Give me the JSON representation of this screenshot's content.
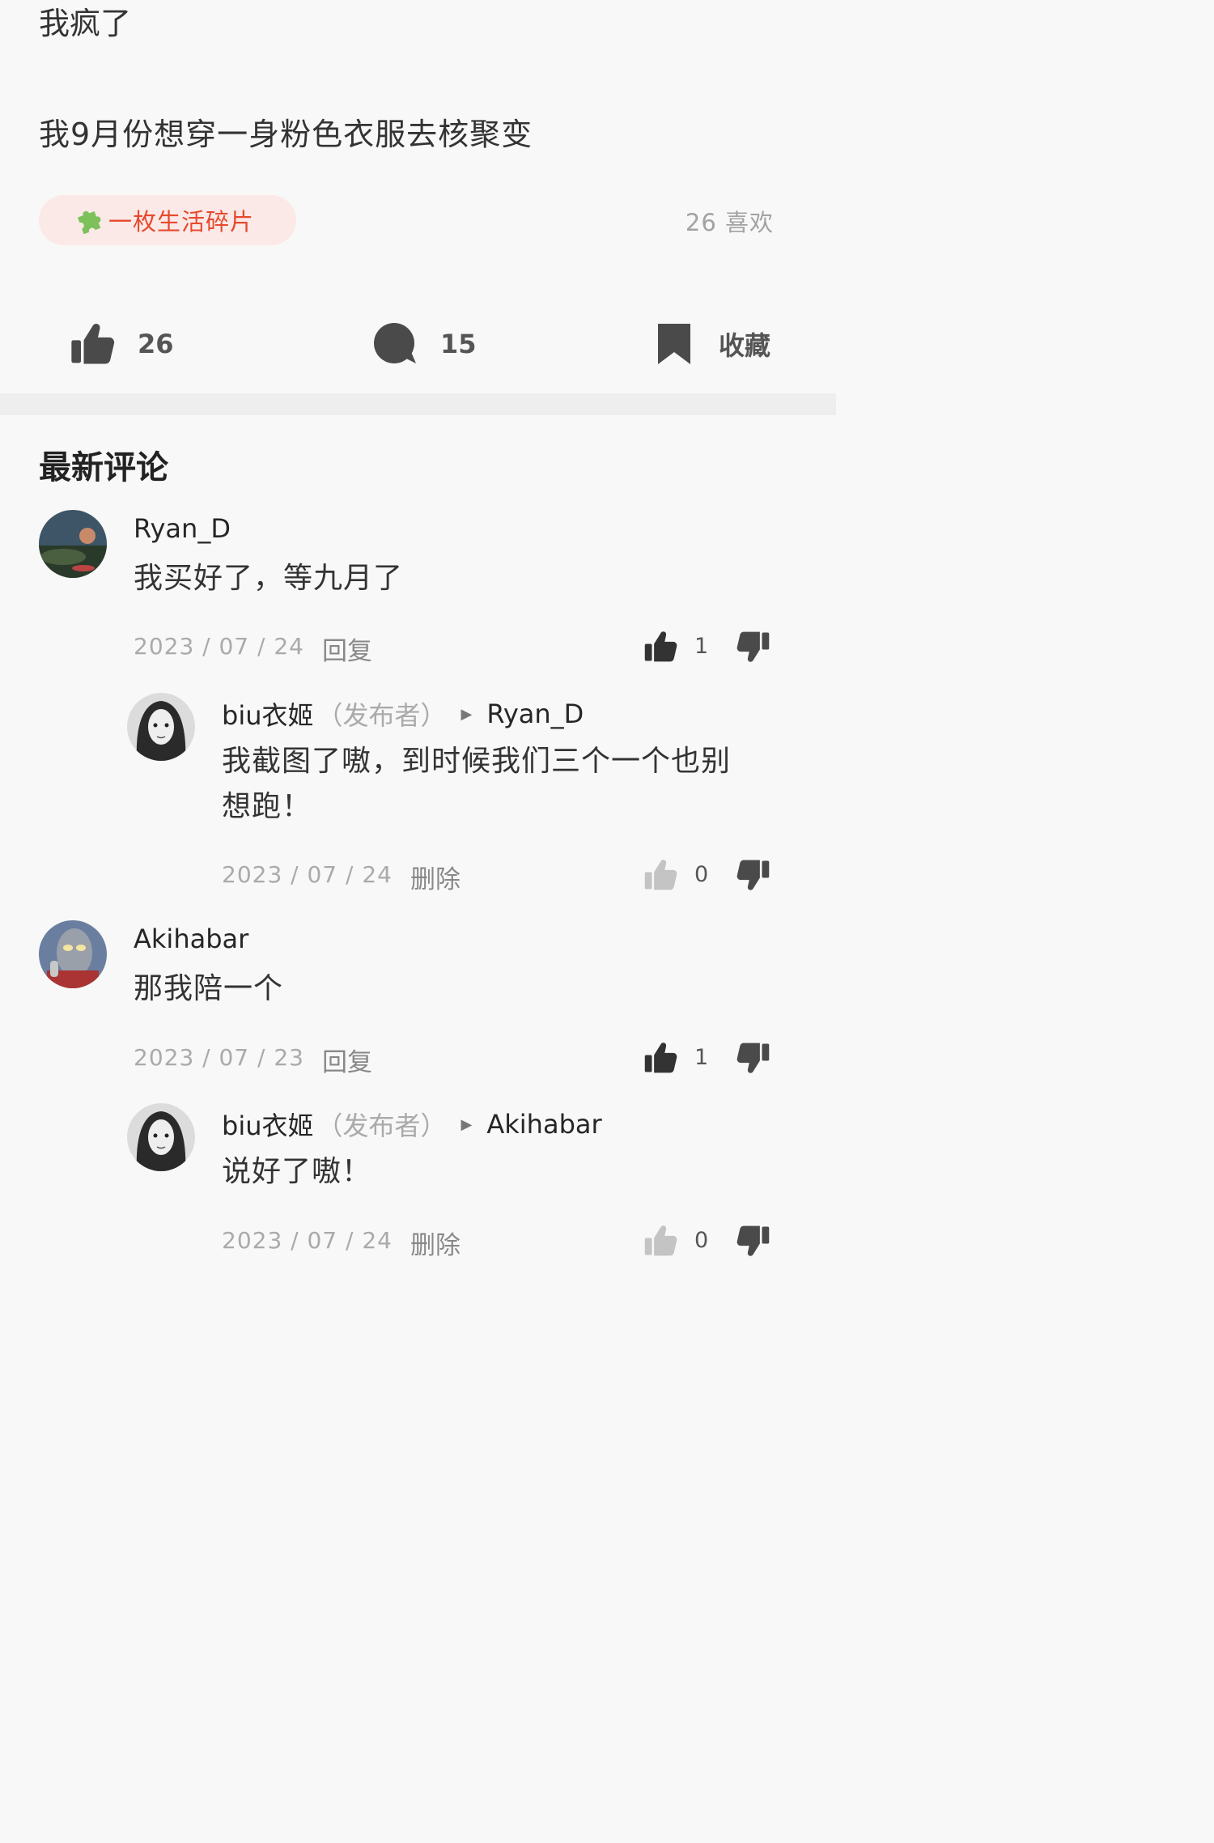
{
  "post": {
    "line1": "我疯了",
    "line2": "我9月份想穿一身粉色衣服去核聚变",
    "tag": {
      "icon": "puzzle-icon",
      "label": "一枚生活碎片"
    },
    "likes_label": "26 喜欢",
    "actions": {
      "like": {
        "icon": "thumbs-up-icon",
        "count": "26"
      },
      "comment": {
        "icon": "comment-bubble-icon",
        "count": "15"
      },
      "favorite": {
        "icon": "bookmark-icon",
        "label": "收藏"
      }
    }
  },
  "comments_section": {
    "title": "最新评论",
    "comments": [
      {
        "author": "Ryan_D",
        "text": "我买好了，等九月了",
        "date": "2023 / 07 / 24",
        "action": "回复",
        "likes": "1",
        "reply": {
          "author": "biu衣姬",
          "publisher_tag": "（发布者）",
          "to": "Ryan_D",
          "text_line1": "我截图了嗷，到时候我们三个一个也别",
          "text_line2": "想跑！",
          "date": "2023 / 07 / 24",
          "action": "删除",
          "likes": "0"
        }
      },
      {
        "author": "Akihabar",
        "text": "那我陪一个",
        "date": "2023 / 07 / 23",
        "action": "回复",
        "likes": "1",
        "reply": {
          "author": "biu衣姬",
          "publisher_tag": "（发布者）",
          "to": "Akihabar",
          "text_line1": "说好了嗷！",
          "date": "2023 / 07 / 24",
          "action": "删除",
          "likes": "0"
        }
      }
    ]
  },
  "colors": {
    "background": "#f8f8f8",
    "tag_bg": "#fbe9e7",
    "tag_text": "#e64a2e",
    "icon_dark": "#4a4a4a",
    "icon_light": "#c4c4c4",
    "divider": "#eeeeee"
  }
}
